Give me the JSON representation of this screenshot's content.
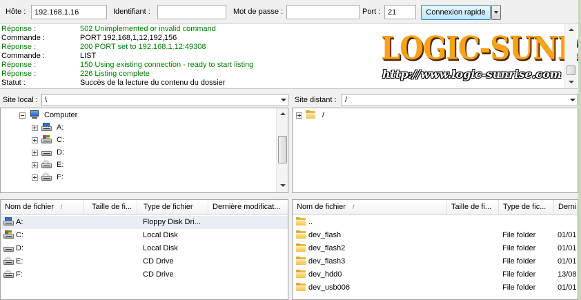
{
  "quickconnect": {
    "host_label": "Hôte :",
    "host_value": "192.168.1.16",
    "user_label": "Identifiant :",
    "user_value": "",
    "pass_label": "Mot de passe :",
    "pass_value": "",
    "port_label": "Port :",
    "port_value": "21",
    "connect_label": "Connexion rapide"
  },
  "log": [
    {
      "type": "Réponse :",
      "message": "502 Unimplemented or invalid command",
      "color": "#008000"
    },
    {
      "type": "Commande :",
      "message": "PORT 192,168,1,12,192,156",
      "color": "#000000"
    },
    {
      "type": "Réponse :",
      "message": "200 PORT set to 192.168.1.12:49308",
      "color": "#008000"
    },
    {
      "type": "Commande :",
      "message": "LIST",
      "color": "#000000"
    },
    {
      "type": "Réponse :",
      "message": "150 Using existing connection - ready to start listing",
      "color": "#008000"
    },
    {
      "type": "Réponse :",
      "message": "226 Listing complete",
      "color": "#008000"
    },
    {
      "type": "Statut :",
      "message": "Succès de la lecture du contenu du dossier",
      "color": "#000000"
    }
  ],
  "watermark": {
    "logo_text": "LOGIC-SUNRISE",
    "url_text": "http://www.logic-sunrise.com"
  },
  "local_site": {
    "label": "Site local :",
    "path": "\\",
    "tree": [
      {
        "label": "Computer",
        "icon": "computer-icon",
        "expander": "minus"
      },
      {
        "label": "A:",
        "icon": "floppy-drive-icon",
        "expander": "plus"
      },
      {
        "label": "C:",
        "icon": "windows-drive-icon",
        "expander": "plus"
      },
      {
        "label": "D:",
        "icon": "local-disk-icon",
        "expander": "plus"
      },
      {
        "label": "E:",
        "icon": "cd-drive-icon",
        "expander": "plus"
      },
      {
        "label": "F:",
        "icon": "cd-drive-icon",
        "expander": "plus"
      }
    ]
  },
  "remote_site": {
    "label": "Site distant :",
    "path": "/",
    "tree": [
      {
        "label": "/",
        "icon": "folder-icon",
        "expander": "plus"
      }
    ]
  },
  "local_files": {
    "columns": [
      "Nom de fichier",
      "Taille de fi...",
      "Type de fichier",
      "Dernière modificat..."
    ],
    "sort_mark": "/",
    "rows": [
      {
        "name": "A:",
        "size": "",
        "type": "Floppy Disk Dri...",
        "modified": "",
        "icon": "floppy-drive-icon",
        "selected": true
      },
      {
        "name": "C:",
        "size": "",
        "type": "Local Disk",
        "modified": "",
        "icon": "windows-drive-icon"
      },
      {
        "name": "D:",
        "size": "",
        "type": "Local Disk",
        "modified": "",
        "icon": "local-disk-icon"
      },
      {
        "name": "E:",
        "size": "",
        "type": "CD Drive",
        "modified": "",
        "icon": "cd-drive-icon"
      },
      {
        "name": "F:",
        "size": "",
        "type": "CD Drive",
        "modified": "",
        "icon": "cd-drive-icon"
      }
    ]
  },
  "remote_files": {
    "columns": [
      "Nom de fichier",
      "Taille de fi...",
      "Type de fic...",
      "Derni"
    ],
    "sort_mark": "/",
    "rows": [
      {
        "name": "..",
        "size": "",
        "type": "",
        "modified": "",
        "icon": "folder-icon"
      },
      {
        "name": "dev_flash",
        "size": "",
        "type": "File folder",
        "modified": "01/01",
        "icon": "folder-icon"
      },
      {
        "name": "dev_flash2",
        "size": "",
        "type": "File folder",
        "modified": "01/01",
        "icon": "folder-icon"
      },
      {
        "name": "dev_flash3",
        "size": "",
        "type": "File folder",
        "modified": "01/01",
        "icon": "folder-icon"
      },
      {
        "name": "dev_hdd0",
        "size": "",
        "type": "File folder",
        "modified": "13/08",
        "icon": "folder-icon"
      },
      {
        "name": "dev_usb006",
        "size": "",
        "type": "File folder",
        "modified": "01/01",
        "icon": "folder-icon"
      }
    ]
  }
}
